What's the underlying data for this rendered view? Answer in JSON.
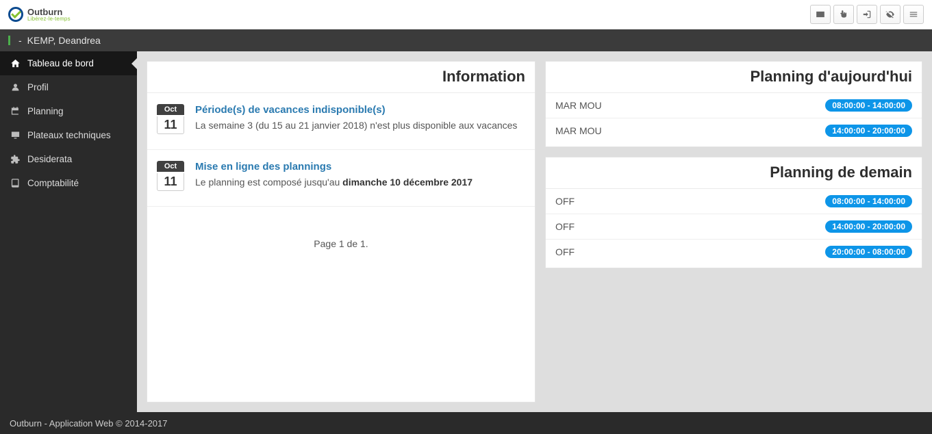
{
  "brand": {
    "name": "Outburn",
    "tagline": "Libérez-le-temps"
  },
  "user": {
    "display": "KEMP, Deandrea",
    "prefix": "-"
  },
  "sidebar": {
    "items": [
      {
        "key": "dashboard",
        "label": "Tableau de bord",
        "active": true
      },
      {
        "key": "profile",
        "label": "Profil"
      },
      {
        "key": "planning",
        "label": "Planning"
      },
      {
        "key": "plateaux",
        "label": "Plateaux techniques"
      },
      {
        "key": "desiderata",
        "label": "Desiderata"
      },
      {
        "key": "compta",
        "label": "Comptabilité"
      }
    ]
  },
  "info_panel": {
    "title": "Information",
    "pager": "Page 1 de 1.",
    "items": [
      {
        "month": "Oct",
        "day": "11",
        "title": "Période(s) de vacances indisponible(s)",
        "body_plain": "La semaine 3 (du 15 au 21 janvier 2018) n'est plus disponible aux vacances",
        "body_strong": ""
      },
      {
        "month": "Oct",
        "day": "11",
        "title": "Mise en ligne des plannings",
        "body_plain": "Le planning est composé jusqu'au ",
        "body_strong": "dimanche 10 décembre 2017"
      }
    ]
  },
  "today_panel": {
    "title": "Planning d'aujourd'hui",
    "rows": [
      {
        "label": "MAR MOU",
        "time": "08:00:00 - 14:00:00"
      },
      {
        "label": "MAR MOU",
        "time": "14:00:00 - 20:00:00"
      }
    ]
  },
  "tomorrow_panel": {
    "title": "Planning de demain",
    "rows": [
      {
        "label": "OFF",
        "time": "08:00:00 - 14:00:00"
      },
      {
        "label": "OFF",
        "time": "14:00:00 - 20:00:00"
      },
      {
        "label": "OFF",
        "time": "20:00:00 - 08:00:00"
      }
    ]
  },
  "footer": {
    "text": "Outburn - Application Web © 2014-2017"
  },
  "icons": {
    "top": [
      "envelope-icon",
      "hand-point-icon",
      "sign-out-icon",
      "eye-slash-icon",
      "menu-icon"
    ]
  }
}
